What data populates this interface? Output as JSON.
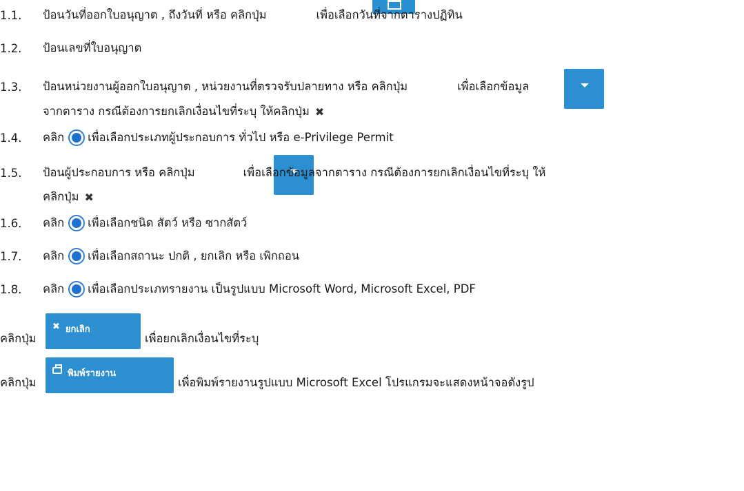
{
  "items": [
    {
      "num": "1.1.",
      "parts": [
        "ป้อนวันที่ออกใบอนุญาต , ถึงวันที่ หรือ คลิกปุ่ม",
        "เพื่อเลือกวันที่จากตารางปฏิทิน"
      ]
    },
    {
      "num": "1.2.",
      "parts": [
        "ป้อนเลขที่ใบอนุญาต"
      ]
    },
    {
      "num": "1.3.",
      "parts": [
        "ป้อนหน่วยงานผู้ออกใบอนุญาต , หน่วยงานที่ตรวจรับปลายทาง หรือ คลิกปุ่ม",
        "เพื่อเลือกข้อมูล"
      ],
      "cont": "จากตาราง  กรณีต้องการยกเลิกเงื่อนไขที่ระบุ ให้คลิกปุ่ม"
    },
    {
      "num": "1.4.",
      "parts": [
        "คลิก",
        "เพื่อเลือกประเภทผู้ประกอบการ ทั่วไป หรือ e-Privilege Permit"
      ]
    },
    {
      "num": "1.5.",
      "parts": [
        "ป้อนผู้ประกอบการ หรือ คลิกปุ่ม",
        "เพื่อเลือกข้อมูลจากตาราง กรณีต้องการยกเลิกเงื่อนไขที่ระบุ ให้"
      ],
      "cont": "คลิกปุ่ม"
    },
    {
      "num": "1.6.",
      "parts": [
        "คลิก",
        "เพื่อเลือกชนิด สัตว์ หรือ ซากสัตว์"
      ]
    },
    {
      "num": "1.7.",
      "parts": [
        "คลิก",
        "เพื่อเลือกสถานะ ปกติ , ยกเลิก หรือ เพิกถอน"
      ]
    },
    {
      "num": "1.8.",
      "parts": [
        "คลิก",
        "เพื่อเลือกประเภทรายงาน เป็นรูปแบบ Microsoft Word, Microsoft Excel, PDF"
      ]
    }
  ],
  "cancel_line": {
    "prefix": "คลิกปุ่ม",
    "button_label": "ยกเลิก",
    "suffix": "เพื่อยกเลิกเงื่อนไขที่ระบุ"
  },
  "print_line": {
    "prefix": "คลิกปุ่ม",
    "button_label": "พิมพ์รายงาน",
    "suffix": "เพื่อพิมพ์รายงานรูปแบบ Microsoft Excel โปรแกรมจะแสดงหน้าจอดังรูป"
  },
  "icons": {
    "calendar": "calendar-icon",
    "dropdown": "caret-down-icon",
    "clear": "times-icon",
    "radio": "radio-selected-icon",
    "print": "print-icon"
  },
  "colors": {
    "button_blue": "#2b8fd2",
    "radio_blue": "#1f6fd0",
    "text": "#1a1a1a"
  }
}
